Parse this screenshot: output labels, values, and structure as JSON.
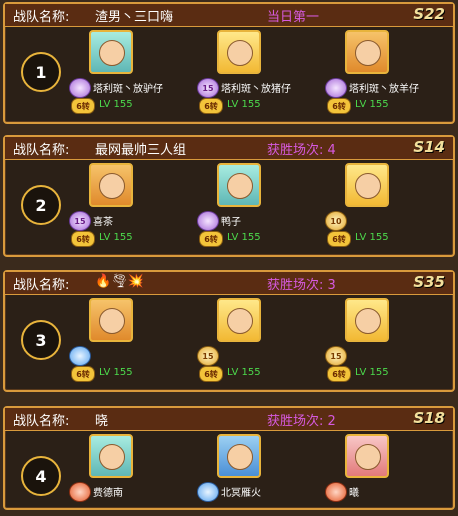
{
  "labels": {
    "team_name_label": "战队名称:"
  },
  "teams": [
    {
      "rank": "1",
      "name": "渣男丶三口嗨",
      "score_text": "当日第一",
      "server": "S22",
      "members": [
        {
          "name": "塔利斑丶放驴仔",
          "badge": "",
          "level_badge": "6转",
          "level": "LV 155"
        },
        {
          "name": "塔利斑丶放猪仔",
          "badge": "15",
          "level_badge": "6转",
          "level": "LV 155"
        },
        {
          "name": "塔利斑丶放羊仔",
          "badge": "",
          "level_badge": "6转",
          "level": "LV 155"
        }
      ]
    },
    {
      "rank": "2",
      "name": "最网最帅三人组",
      "score_text": "获胜场次: 4",
      "server": "S14",
      "members": [
        {
          "name": "喜茶",
          "badge": "15",
          "level_badge": "6转",
          "level": "LV 155"
        },
        {
          "name": "鸭子",
          "badge": "",
          "level_badge": "6转",
          "level": "LV 155"
        },
        {
          "name": "",
          "badge": "10",
          "level_badge": "6转",
          "level": "LV 155"
        }
      ]
    },
    {
      "rank": "3",
      "name": "🔥🌪💥",
      "score_text": "获胜场次: 3",
      "server": "S35",
      "members": [
        {
          "name": "",
          "badge": "",
          "level_badge": "6转",
          "level": "LV 155"
        },
        {
          "name": "",
          "badge": "15",
          "level_badge": "6转",
          "level": "LV 155"
        },
        {
          "name": "",
          "badge": "15",
          "level_badge": "6转",
          "level": "LV 155"
        }
      ]
    },
    {
      "rank": "4",
      "name": "晓",
      "score_text": "获胜场次: 2",
      "server": "S18",
      "members": [
        {
          "name": "费德南",
          "badge": "",
          "level_badge": "",
          "level": ""
        },
        {
          "name": "北冥雁火",
          "badge": "",
          "level_badge": "",
          "level": ""
        },
        {
          "name": "曦",
          "badge": "",
          "level_badge": "",
          "level": ""
        }
      ]
    }
  ]
}
